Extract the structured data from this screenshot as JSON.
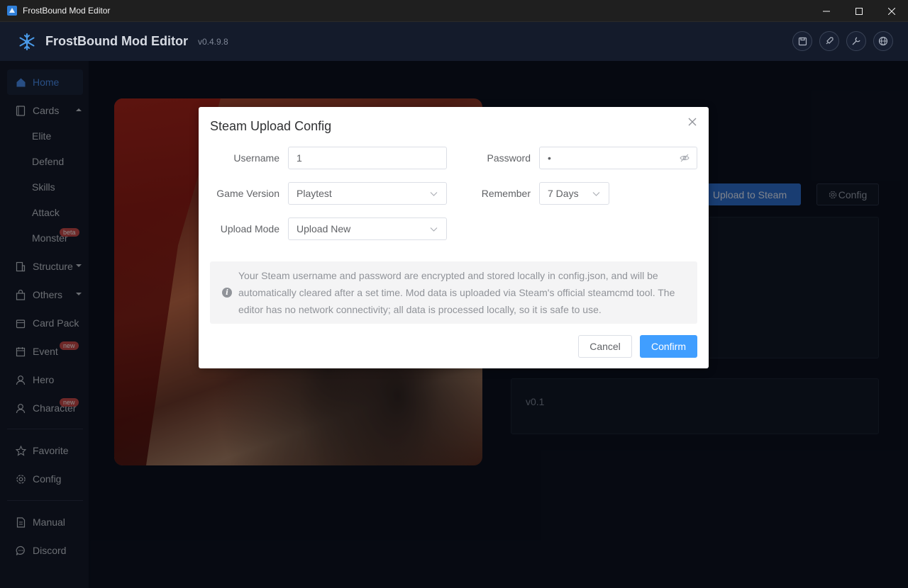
{
  "window": {
    "title": "FrostBound Mod Editor"
  },
  "header": {
    "app_name": "FrostBound Mod Editor",
    "version": "v0.4.9.8",
    "tools": [
      "save-icon",
      "rocket-icon",
      "wrench-icon",
      "globe-icon"
    ]
  },
  "sidebar": {
    "home": "Home",
    "cards": "Cards",
    "cards_sub": [
      "Elite",
      "Defend",
      "Skills",
      "Attack",
      "Monster"
    ],
    "monster_badge": "beta",
    "structure": "Structure",
    "others": "Others",
    "card_pack": "Card Pack",
    "event": "Event",
    "event_badge": "new",
    "hero": "Hero",
    "character": "Character",
    "character_badge": "new",
    "favorite": "Favorite",
    "config": "Config",
    "manual": "Manual",
    "discord": "Discord"
  },
  "main": {
    "upload_label": "Upload to Steam",
    "config_label": "Config",
    "version_text": "v0.1"
  },
  "dialog": {
    "title": "Steam Upload Config",
    "username_label": "Username",
    "username_value": "1",
    "password_label": "Password",
    "password_value": "•",
    "game_version_label": "Game Version",
    "game_version_value": "Playtest",
    "remember_label": "Remember",
    "remember_value": "7 Days",
    "upload_mode_label": "Upload Mode",
    "upload_mode_value": "Upload New",
    "info_text": "Your Steam username and password are encrypted and stored locally in config.json, and will be automatically cleared after a set time. Mod data is uploaded via Steam's official steamcmd tool. The editor has no network connectivity; all data is processed locally, so it is safe to use.",
    "cancel_label": "Cancel",
    "confirm_label": "Confirm"
  },
  "colors": {
    "accent": "#409eff",
    "sidebar_active": "#4a8ff0",
    "badge": "#c94a4a"
  }
}
